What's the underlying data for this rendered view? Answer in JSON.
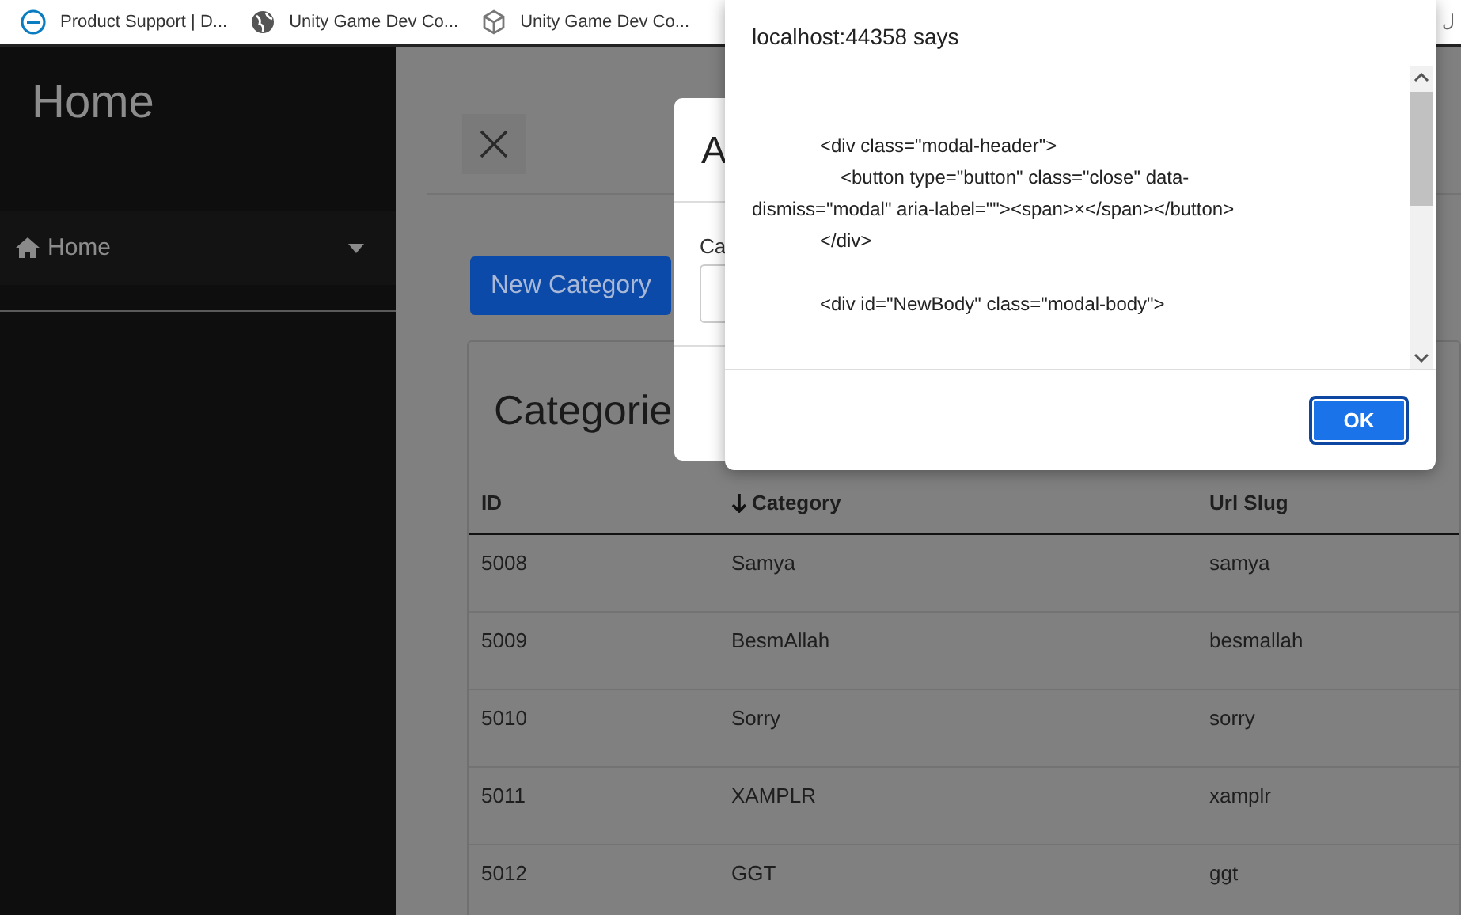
{
  "bookmarks_bar": {
    "items": [
      {
        "kind": "dell",
        "label": "Product Support | D..."
      },
      {
        "kind": "globe",
        "label": "Unity Game Dev Co..."
      },
      {
        "kind": "unity",
        "label": "Unity Game Dev Co..."
      }
    ],
    "edge_text": "ل"
  },
  "sidebar": {
    "title": "Home",
    "items": [
      {
        "label": "Home",
        "expanded": false
      }
    ]
  },
  "main": {
    "new_button": "New Category",
    "card_title": "Categorie",
    "table": {
      "columns": [
        {
          "label": "ID",
          "sorted": false
        },
        {
          "label": "Category",
          "sorted": true
        },
        {
          "label": "Url Slug",
          "sorted": false
        }
      ],
      "rows": [
        [
          "5008",
          "Samya",
          "samya"
        ],
        [
          "5009",
          "BesmAllah",
          "besmallah"
        ],
        [
          "5010",
          "Sorry",
          "sorry"
        ],
        [
          "5011",
          "XAMPLR",
          "xamplr"
        ],
        [
          "5012",
          "GGT",
          "ggt"
        ]
      ]
    }
  },
  "modal": {
    "title": "A",
    "field_label": "Ca"
  },
  "alert": {
    "title": "localhost:44358 says",
    "paragraphs": [
      [
        {
          "kind": "indented",
          "text": "<div class=\"modal-header\">"
        },
        {
          "kind": "nested",
          "text": "<button type=\"button\" class=\"close\" data-"
        },
        {
          "kind": "flush",
          "text": "dismiss=\"modal\" aria-label=\"\"><span>×</span></button>"
        },
        {
          "kind": "indented",
          "text": "</div>"
        }
      ],
      [
        {
          "kind": "indented",
          "text": "<div id=\"NewBody\" class=\"modal-body\">"
        }
      ]
    ],
    "ok": "OK"
  }
}
